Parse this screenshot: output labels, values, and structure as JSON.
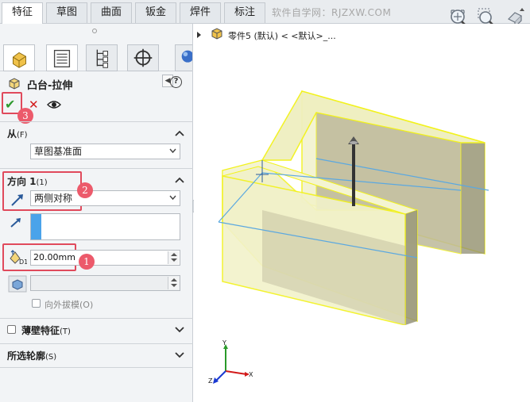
{
  "tabs": [
    {
      "label": "特征",
      "active": true
    },
    {
      "label": "草图",
      "active": false
    },
    {
      "label": "曲面",
      "active": false
    },
    {
      "label": "钣金",
      "active": false
    },
    {
      "label": "焊件",
      "active": false
    },
    {
      "label": "标注",
      "active": false
    }
  ],
  "watermark": "软件自学网：RJZXW.COM",
  "toolbar_icons": [
    "zoom-to-fit-icon",
    "zoom-area-icon",
    "previous-view-icon"
  ],
  "manager_tabs": [
    "featuremanager-icon",
    "propertymanager-icon",
    "configurationmanager-icon",
    "dimxpert-icon",
    "appearance-icon"
  ],
  "feature": {
    "title": "凸台-拉伸",
    "help": "?"
  },
  "from": {
    "label": "从",
    "suffix": "(F)",
    "value": "草图基准面"
  },
  "direction1": {
    "label": "方向 1",
    "suffix": "(1)",
    "end_condition": "两侧对称",
    "depth": "20.00mm",
    "draft_outward": "向外拔模",
    "draft_suffix": "(O)"
  },
  "thin_feature": {
    "label": "薄壁特征",
    "suffix": "(T)"
  },
  "selected_contours": {
    "label": "所选轮廓",
    "suffix": "(S)"
  },
  "annotations": [
    "1",
    "2",
    "3"
  ],
  "tree": {
    "text": "零件5 (默认) < <默认>_..."
  },
  "triad": {
    "x": "X",
    "y": "Y",
    "z": "Z"
  },
  "colors": {
    "annotation": "#e04a5c",
    "model_face": "#efefc0",
    "model_edge": "#f2f21a",
    "sketch_line": "#5ba8e0",
    "ok": "#2f9a2f",
    "cancel": "#d21b1b"
  }
}
